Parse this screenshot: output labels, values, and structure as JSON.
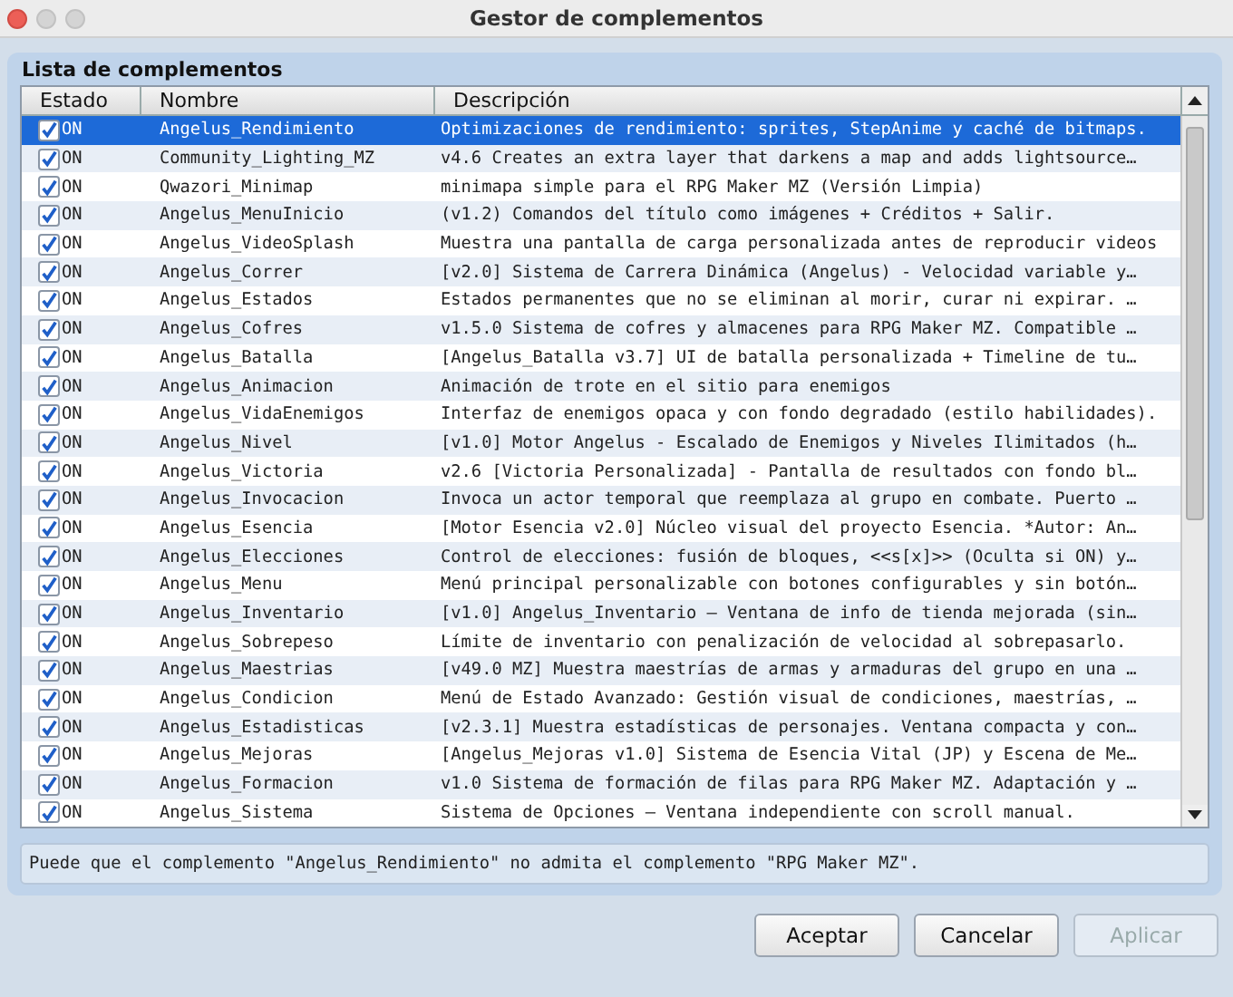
{
  "window": {
    "title": "Gestor de complementos"
  },
  "panel": {
    "title": "Lista de complementos"
  },
  "table": {
    "columns": [
      "Estado",
      "Nombre",
      "Descripción"
    ],
    "rows": [
      {
        "checked": true,
        "status": "ON",
        "name": "Angelus_Rendimiento",
        "description": "Optimizaciones de rendimiento: sprites, StepAnime y caché de bitmaps.",
        "selected": true
      },
      {
        "checked": true,
        "status": "ON",
        "name": "Community_Lighting_MZ",
        "description": "v4.6 Creates an extra layer that darkens a map and adds lightsource…",
        "selected": false
      },
      {
        "checked": true,
        "status": "ON",
        "name": "Qwazori_Minimap",
        "description": "minimapa simple para el RPG Maker MZ (Versión Limpia)",
        "selected": false
      },
      {
        "checked": true,
        "status": "ON",
        "name": "Angelus_MenuInicio",
        "description": "(v1.2) Comandos del título como imágenes + Créditos + Salir.",
        "selected": false
      },
      {
        "checked": true,
        "status": "ON",
        "name": "Angelus_VideoSplash",
        "description": "Muestra una pantalla de carga personalizada antes de reproducir videos",
        "selected": false
      },
      {
        "checked": true,
        "status": "ON",
        "name": "Angelus_Correr",
        "description": "[v2.0] Sistema de Carrera Dinámica (Angelus) - Velocidad variable y…",
        "selected": false
      },
      {
        "checked": true,
        "status": "ON",
        "name": "Angelus_Estados",
        "description": "Estados permanentes que no se eliminan al morir, curar ni expirar. …",
        "selected": false
      },
      {
        "checked": true,
        "status": "ON",
        "name": "Angelus_Cofres",
        "description": "v1.5.0 Sistema de cofres y almacenes para RPG Maker MZ. Compatible …",
        "selected": false
      },
      {
        "checked": true,
        "status": "ON",
        "name": "Angelus_Batalla",
        "description": "[Angelus_Batalla v3.7] UI de batalla personalizada + Timeline de tu…",
        "selected": false
      },
      {
        "checked": true,
        "status": "ON",
        "name": "Angelus_Animacion",
        "description": "Animación de trote en el sitio para enemigos",
        "selected": false
      },
      {
        "checked": true,
        "status": "ON",
        "name": "Angelus_VidaEnemigos",
        "description": "Interfaz de enemigos opaca y con fondo degradado (estilo habilidades).",
        "selected": false
      },
      {
        "checked": true,
        "status": "ON",
        "name": "Angelus_Nivel",
        "description": "[v1.0] Motor Angelus - Escalado de Enemigos y Niveles Ilimitados (h…",
        "selected": false
      },
      {
        "checked": true,
        "status": "ON",
        "name": "Angelus_Victoria",
        "description": "v2.6 [Victoria Personalizada] - Pantalla de resultados con fondo bl…",
        "selected": false
      },
      {
        "checked": true,
        "status": "ON",
        "name": "Angelus_Invocacion",
        "description": "Invoca un actor temporal que reemplaza al grupo en combate. Puerto …",
        "selected": false
      },
      {
        "checked": true,
        "status": "ON",
        "name": "Angelus_Esencia",
        "description": "[Motor Esencia v2.0] Núcleo visual del proyecto Esencia. *Autor: An…",
        "selected": false
      },
      {
        "checked": true,
        "status": "ON",
        "name": "Angelus_Elecciones",
        "description": "Control de elecciones: fusión de bloques, <<s[x]>> (Oculta si ON) y…",
        "selected": false
      },
      {
        "checked": true,
        "status": "ON",
        "name": "Angelus_Menu",
        "description": "Menú principal personalizable con botones configurables y sin botón…",
        "selected": false
      },
      {
        "checked": true,
        "status": "ON",
        "name": "Angelus_Inventario",
        "description": "[v1.0] Angelus_Inventario – Ventana de info de tienda mejorada (sin…",
        "selected": false
      },
      {
        "checked": true,
        "status": "ON",
        "name": "Angelus_Sobrepeso",
        "description": "Límite de inventario con penalización de velocidad al sobrepasarlo.",
        "selected": false
      },
      {
        "checked": true,
        "status": "ON",
        "name": "Angelus_Maestrias",
        "description": "[v49.0 MZ] Muestra maestrías de armas y armaduras del grupo en una …",
        "selected": false
      },
      {
        "checked": true,
        "status": "ON",
        "name": "Angelus_Condicion",
        "description": "Menú de Estado Avanzado: Gestión visual de condiciones, maestrías, …",
        "selected": false
      },
      {
        "checked": true,
        "status": "ON",
        "name": "Angelus_Estadisticas",
        "description": "[v2.3.1] Muestra estadísticas de personajes. Ventana compacta y con…",
        "selected": false
      },
      {
        "checked": true,
        "status": "ON",
        "name": "Angelus_Mejoras",
        "description": "[Angelus_Mejoras v1.0] Sistema de Esencia Vital (JP) y Escena de Me…",
        "selected": false
      },
      {
        "checked": true,
        "status": "ON",
        "name": "Angelus_Formacion",
        "description": "v1.0 Sistema de formación de filas para RPG Maker MZ. Adaptación y …",
        "selected": false
      },
      {
        "checked": true,
        "status": "ON",
        "name": "Angelus_Sistema",
        "description": "Sistema de Opciones – Ventana independiente con scroll manual.",
        "selected": false
      }
    ]
  },
  "message": "Puede que el complemento \"Angelus_Rendimiento\" no admita el complemento \"RPG Maker MZ\".",
  "buttons": [
    {
      "label": "Aceptar",
      "disabled": false
    },
    {
      "label": "Cancelar",
      "disabled": false
    },
    {
      "label": "Aplicar",
      "disabled": true
    }
  ]
}
